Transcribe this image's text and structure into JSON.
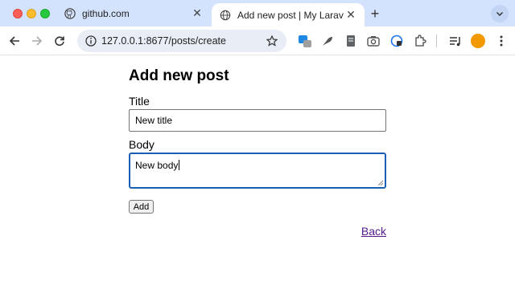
{
  "browser": {
    "tabs": [
      {
        "title": "github.com",
        "icon": "github-icon",
        "active": false
      },
      {
        "title": "Add new post | My Laravel Ap",
        "icon": "globe-icon",
        "active": true
      }
    ],
    "address": "127.0.0.1:8677/posts/create",
    "colors": {
      "tabstrip": "#d3e3fd",
      "omnibox": "#e9eef6",
      "profile": "#f29900"
    }
  },
  "page": {
    "heading": "Add new post",
    "title_label": "Title",
    "title_value": "New title",
    "body_label": "Body",
    "body_value": "New body",
    "add_button": "Add",
    "back_link": "Back",
    "colors": {
      "focus": "#1a5fb4",
      "visited_link": "#551a8b"
    }
  }
}
